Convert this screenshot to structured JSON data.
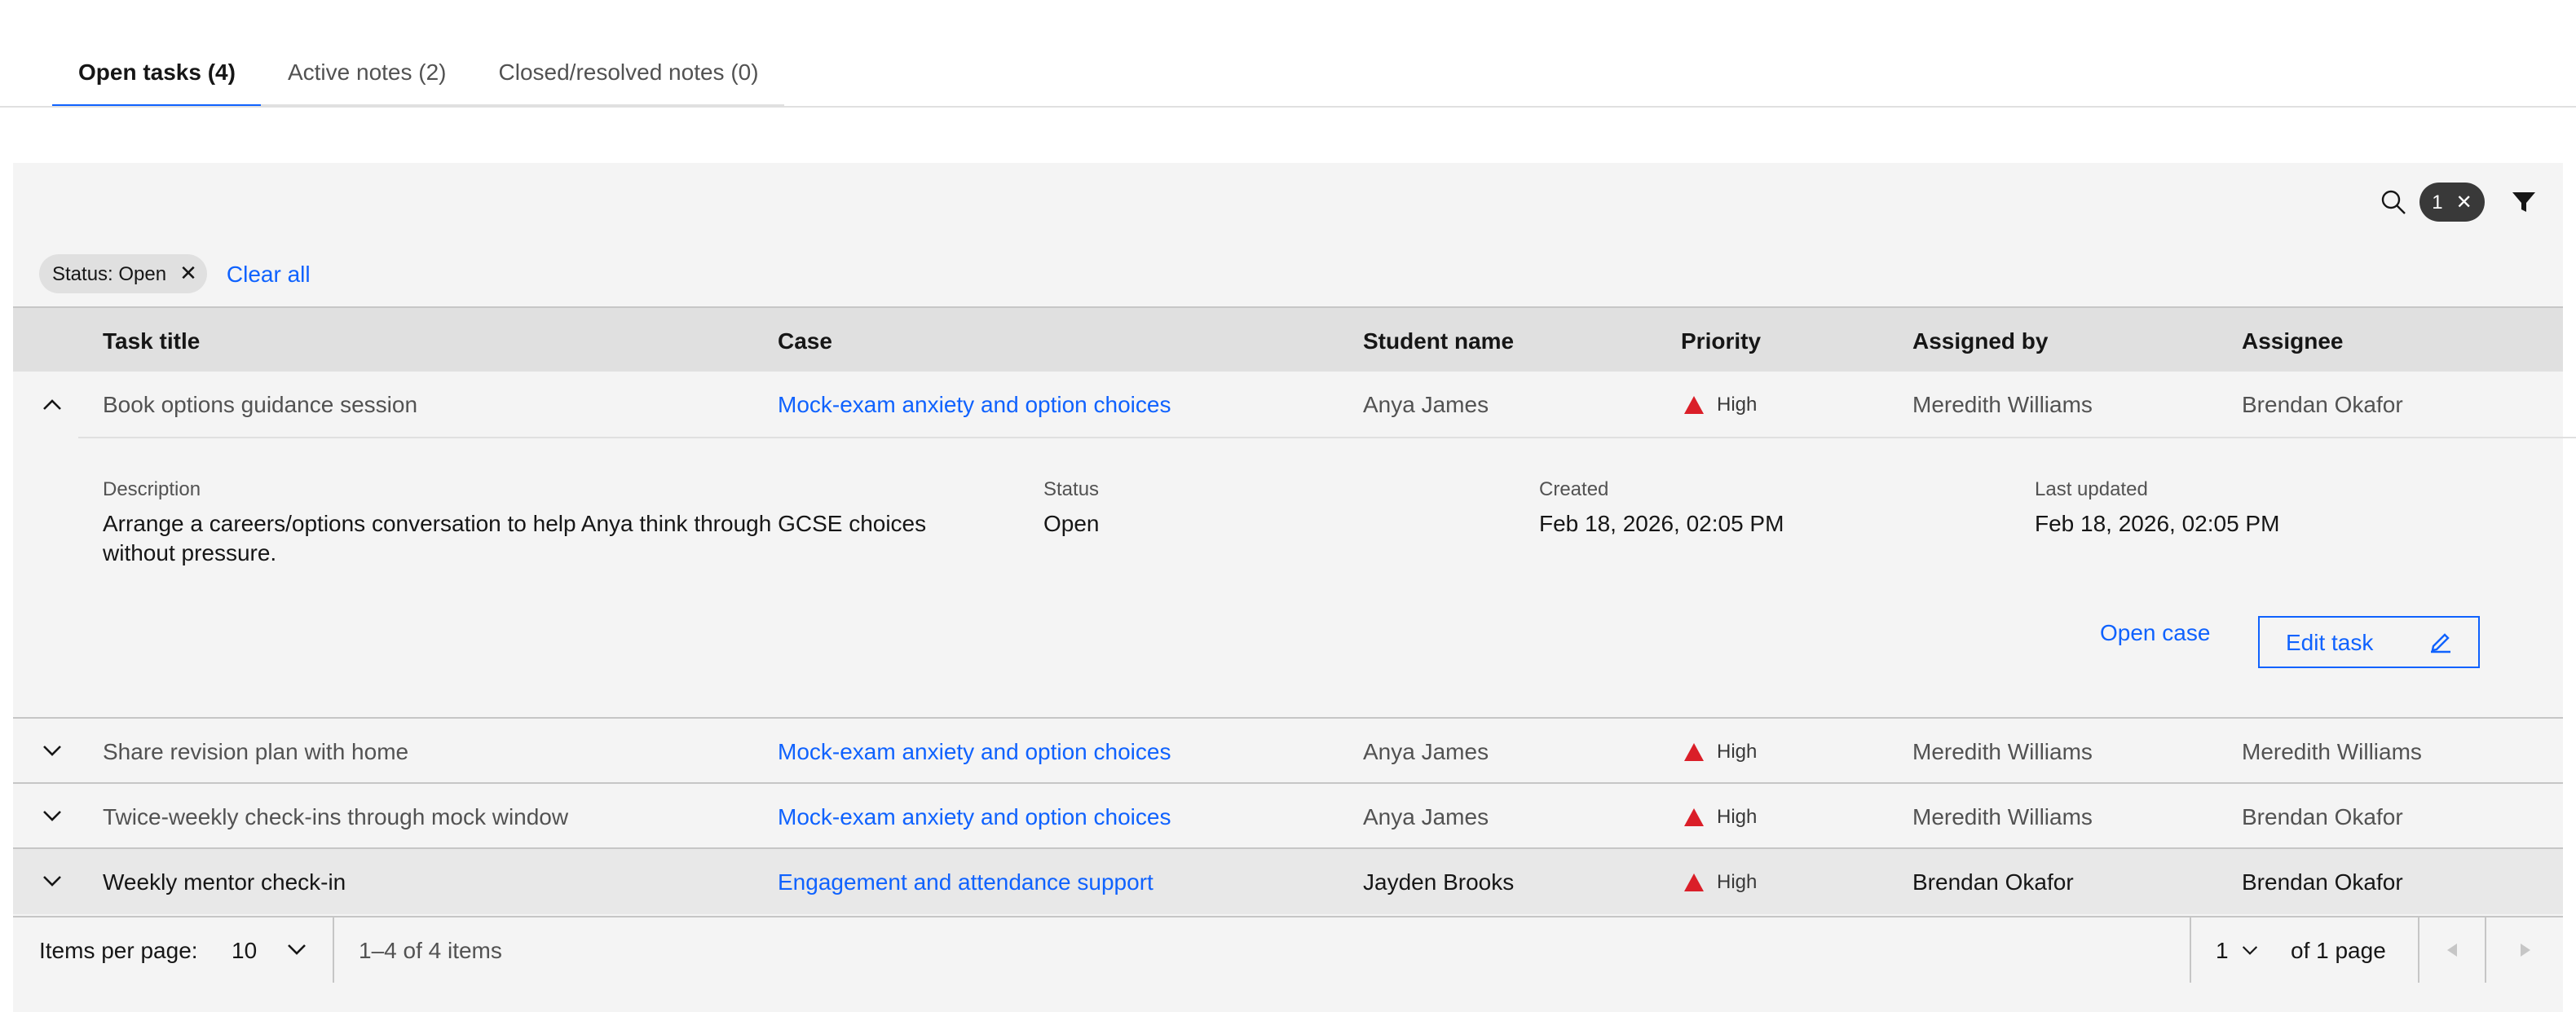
{
  "tabs": [
    {
      "label": "Open tasks (4)"
    },
    {
      "label": "Active notes (2)"
    },
    {
      "label": "Closed/resolved notes (0)"
    }
  ],
  "toolbar": {
    "filter_count": "1"
  },
  "filters": {
    "chip_label": "Status: Open",
    "clear_all": "Clear all"
  },
  "table": {
    "headers": [
      "Task title",
      "Case",
      "Student name",
      "Priority",
      "Assigned by",
      "Assignee"
    ],
    "rows": [
      {
        "title": "Book options guidance session",
        "case": "Mock-exam anxiety and option choices",
        "student": "Anya James",
        "priority": "High",
        "assigned_by": "Meredith Williams",
        "assignee": "Brendan Okafor"
      },
      {
        "title": "Share revision plan with home",
        "case": "Mock-exam anxiety and option choices",
        "student": "Anya James",
        "priority": "High",
        "assigned_by": "Meredith Williams",
        "assignee": "Meredith Williams"
      },
      {
        "title": "Twice-weekly check-ins through mock window",
        "case": "Mock-exam anxiety and option choices",
        "student": "Anya James",
        "priority": "High",
        "assigned_by": "Meredith Williams",
        "assignee": "Brendan Okafor"
      },
      {
        "title": "Weekly mentor check-in",
        "case": "Engagement and attendance support",
        "student": "Jayden Brooks",
        "priority": "High",
        "assigned_by": "Brendan Okafor",
        "assignee": "Brendan Okafor"
      }
    ]
  },
  "detail": {
    "description_label": "Description",
    "description": "Arrange a careers/options conversation to help Anya think through GCSE choices without pressure.",
    "status_label": "Status",
    "status": "Open",
    "created_label": "Created",
    "created": "Feb 18, 2026, 02:05 PM",
    "updated_label": "Last updated",
    "updated": "Feb 18, 2026, 02:05 PM",
    "open_case": "Open case",
    "edit_task": "Edit task"
  },
  "pagination": {
    "items_per_page_label": "Items per page:",
    "items_per_page": "10",
    "range": "1–4 of 4 items",
    "page": "1",
    "of_pages": "of 1 page"
  },
  "colors": {
    "accent": "#0f62fe",
    "priority_high": "#da1e28"
  }
}
